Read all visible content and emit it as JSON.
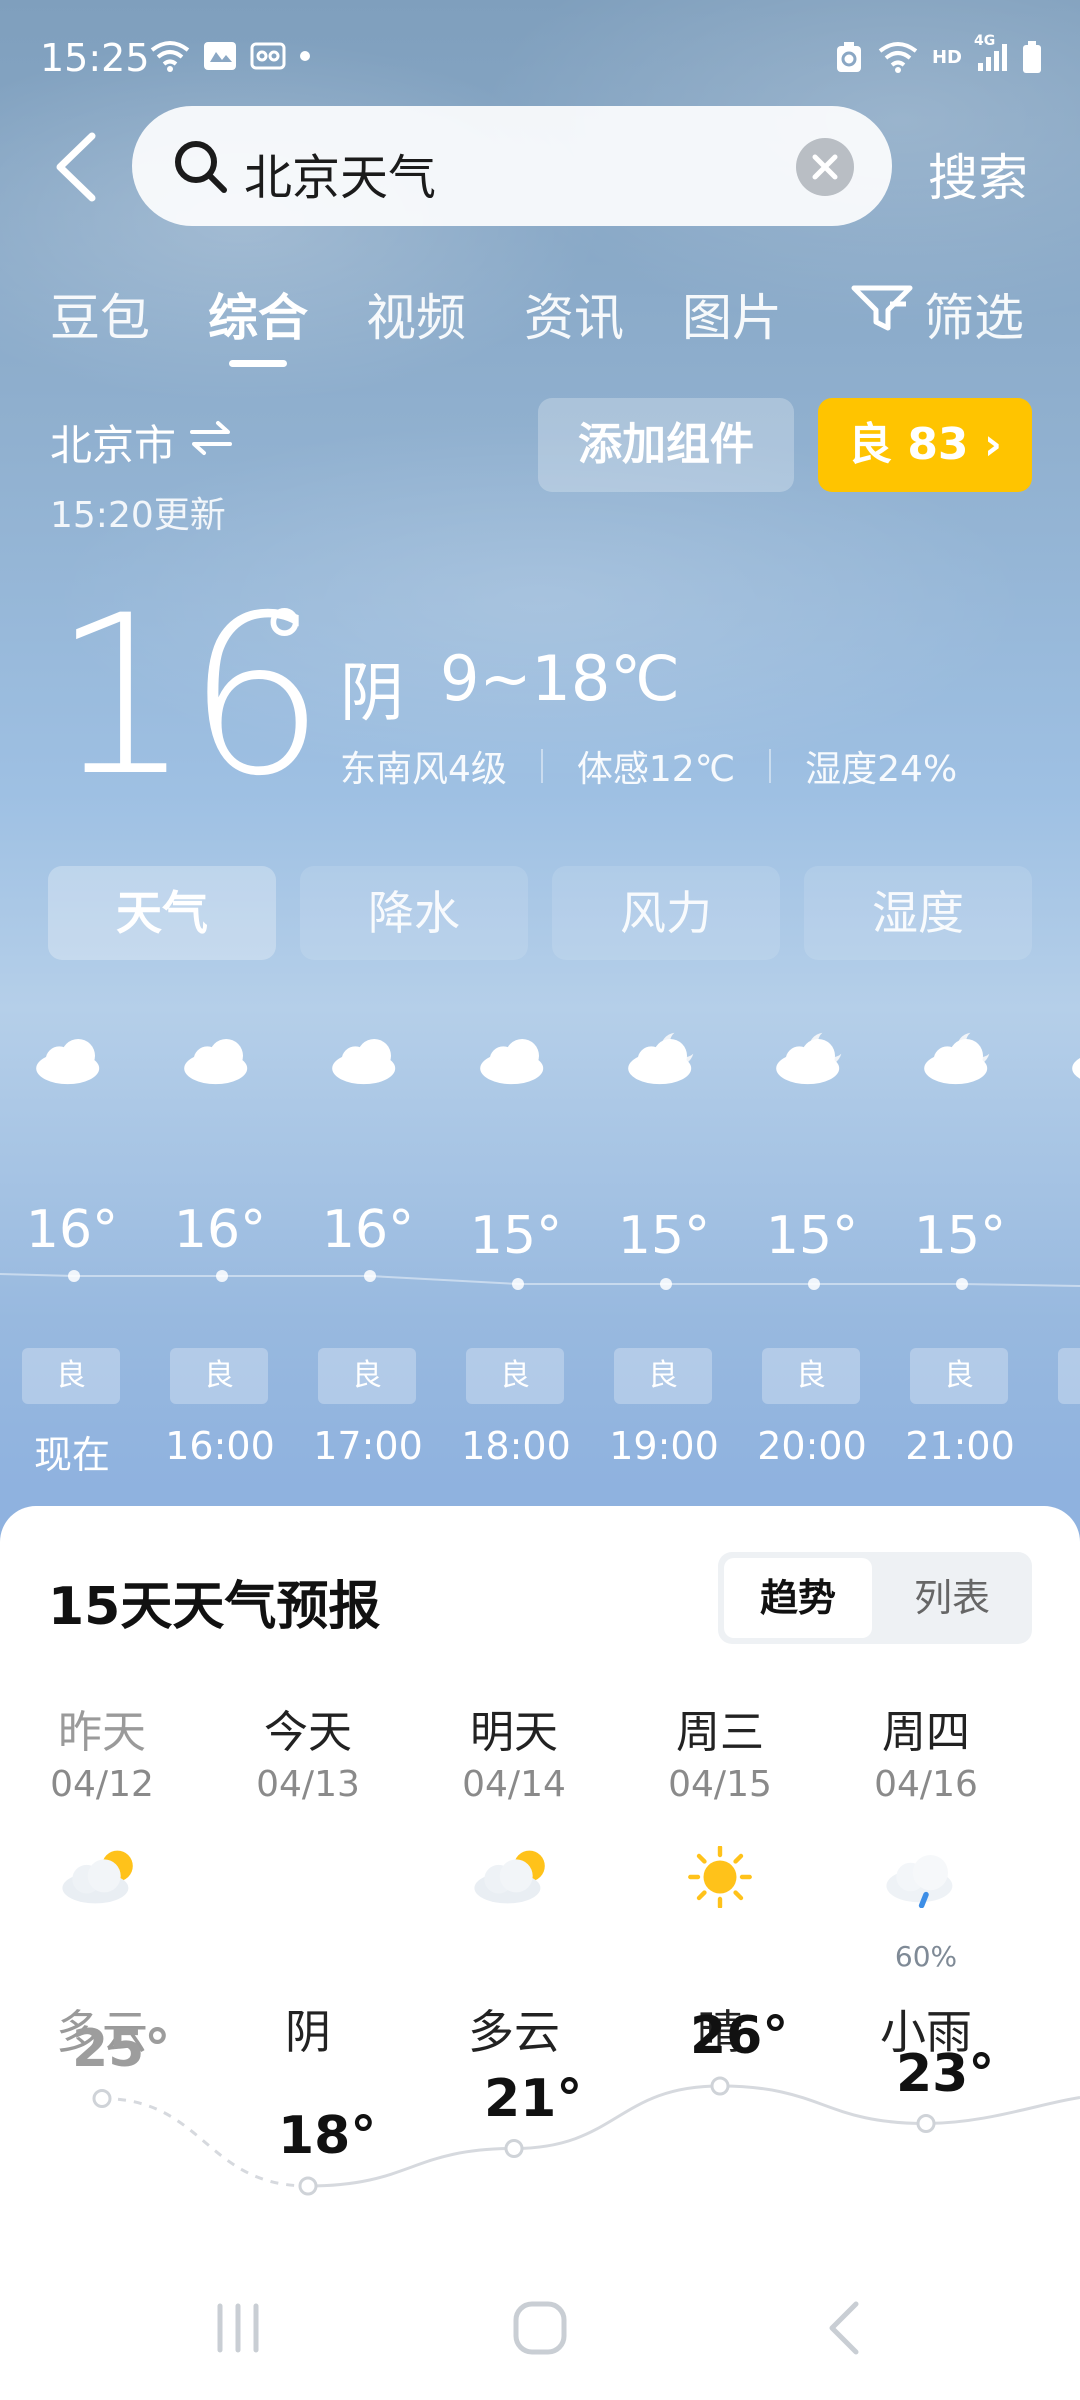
{
  "status_bar": {
    "time": "15:25",
    "network": "HD",
    "signal_type": "4G"
  },
  "search": {
    "query": "北京天气",
    "button_label": "搜索"
  },
  "tabs": [
    {
      "label": "豆包"
    },
    {
      "label": "综合"
    },
    {
      "label": "视频"
    },
    {
      "label": "资讯"
    },
    {
      "label": "图片"
    }
  ],
  "filter_label": "筛选",
  "location": {
    "city": "北京市",
    "updated": "15:20更新"
  },
  "buttons": {
    "add_widget": "添加组件",
    "aqi": "良 83 ›"
  },
  "current": {
    "temp": "16",
    "condition": "阴",
    "range": "9~18℃",
    "wind": "东南风4级",
    "feels_like": "体感12℃",
    "humidity": "湿度24%"
  },
  "category_tabs": [
    {
      "label": "天气"
    },
    {
      "label": "降水"
    },
    {
      "label": "风力"
    },
    {
      "label": "湿度"
    }
  ],
  "hourly": [
    {
      "time": "现在",
      "temp": "16°",
      "aqi": "良",
      "icon": "cloud-icon",
      "temp_value": 16
    },
    {
      "time": "16:00",
      "temp": "16°",
      "aqi": "良",
      "icon": "cloud-icon",
      "temp_value": 16
    },
    {
      "time": "17:00",
      "temp": "16°",
      "aqi": "良",
      "icon": "cloud-icon",
      "temp_value": 16
    },
    {
      "time": "18:00",
      "temp": "15°",
      "aqi": "良",
      "icon": "cloud-icon",
      "temp_value": 15
    },
    {
      "time": "19:00",
      "temp": "15°",
      "aqi": "良",
      "icon": "cloudy-night-icon",
      "temp_value": 15
    },
    {
      "time": "20:00",
      "temp": "15°",
      "aqi": "良",
      "icon": "cloudy-night-icon",
      "temp_value": 15
    },
    {
      "time": "21:00",
      "temp": "15°",
      "aqi": "良",
      "icon": "cloudy-night-icon",
      "temp_value": 15
    }
  ],
  "forecast": {
    "title": "15天天气预报",
    "toggle_trend": "趋势",
    "toggle_list": "列表",
    "days": [
      {
        "name": "昨天",
        "date": "04/12",
        "condition": "多云",
        "high": "25°",
        "high_value": 25,
        "icon": "partly-cloudy-icon",
        "pop": "",
        "past": true
      },
      {
        "name": "今天",
        "date": "04/13",
        "condition": "阴",
        "high": "18°",
        "high_value": 18,
        "icon": "cloud-icon",
        "pop": "",
        "past": false
      },
      {
        "name": "明天",
        "date": "04/14",
        "condition": "多云",
        "high": "21°",
        "high_value": 21,
        "icon": "partly-cloudy-icon",
        "pop": "",
        "past": false
      },
      {
        "name": "周三",
        "date": "04/15",
        "condition": "晴",
        "high": "26°",
        "high_value": 26,
        "icon": "sun-icon",
        "pop": "",
        "past": false
      },
      {
        "name": "周四",
        "date": "04/16",
        "condition": "小雨",
        "high": "23°",
        "high_value": 23,
        "icon": "rain-icon",
        "pop": "60%",
        "past": false
      }
    ]
  },
  "colors": {
    "aqi_yellow": "#ffc400",
    "sun": "#ffc21a",
    "text_dark": "#111111"
  }
}
